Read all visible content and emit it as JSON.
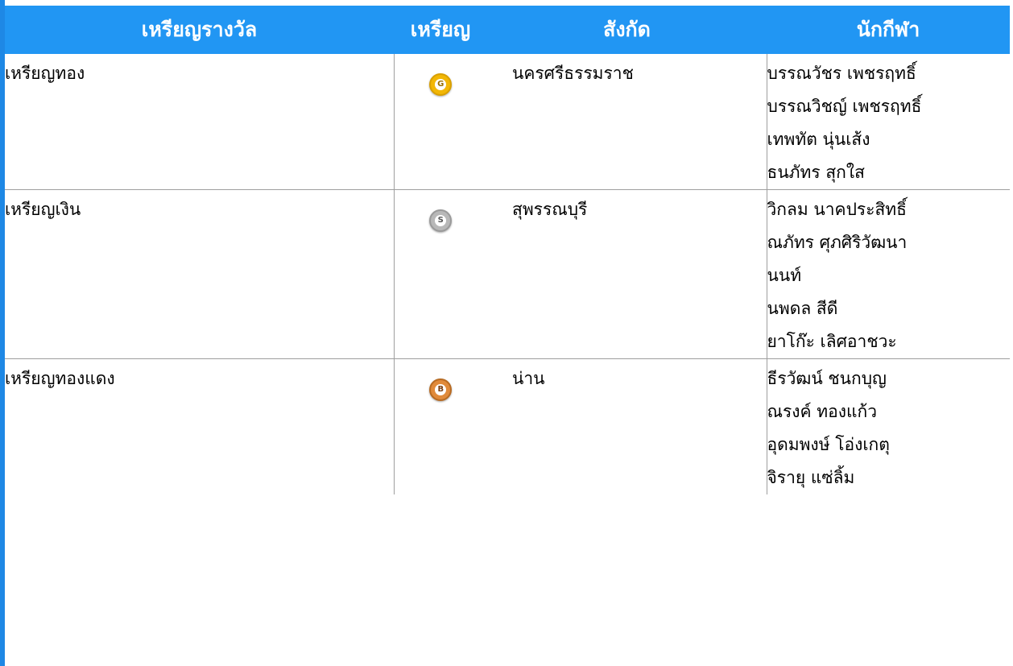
{
  "header": {
    "col_award": "เหรียญรางวัล",
    "col_medal": "เหรียญ",
    "col_affiliation": "สังกัด",
    "col_athletes": "นักกีฬา"
  },
  "rows": [
    {
      "award": "เหรียญทอง",
      "medal_icon": "gold-medal-icon",
      "medal_letter": "G",
      "affiliation": "นครศรีธรรมราช",
      "athletes": [
        "บรรณวัชร เพชรฤทธิ์",
        "บรรณวิชญ์ เพชรฤทธิ์",
        "เทพทัต นุ่นเส้ง",
        "ธนภัทร สุกใส"
      ]
    },
    {
      "award": "เหรียญเงิน",
      "medal_icon": "silver-medal-icon",
      "medal_letter": "S",
      "affiliation": "สุพรรณบุรี",
      "athletes": [
        "วิกลม นาคประสิทธิ์",
        "ณภัทร ศุภศิริวัฒนา",
        "นนท์",
        "นพดล สีดี",
        "ยาโก๊ะ เลิศอาชวะ"
      ]
    },
    {
      "award": "เหรียญทองแดง",
      "medal_icon": "bronze-medal-icon",
      "medal_letter": "B",
      "affiliation": "น่าน",
      "athletes": [
        "ธีรวัฒน์ ชนกบุญ",
        "ณรงค์ ทองแก้ว",
        "อุดมพงษ์ โอ่งเกตุ",
        "จิรายุ แซ่ลิ้ม"
      ]
    }
  ],
  "colors": {
    "header_bg": "#2196f3",
    "header_text": "#ffffff",
    "gold": "#f2b705",
    "silver": "#b8b8b8",
    "bronze": "#e08a3a"
  }
}
